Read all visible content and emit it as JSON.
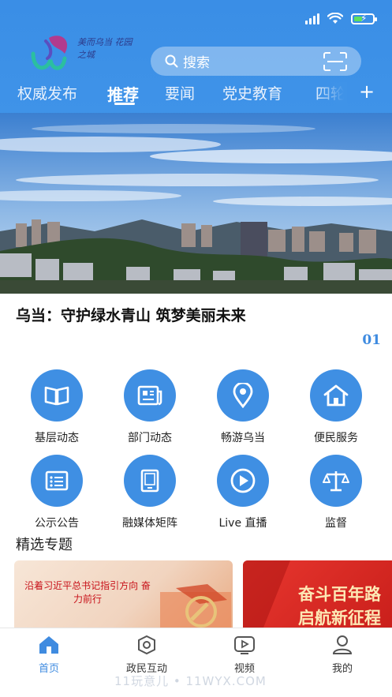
{
  "status_bar": {
    "battery_level": 0.4,
    "signal_icon": "signal-icon",
    "wifi_icon": "wifi-icon",
    "battery_icon": "battery-icon"
  },
  "header": {
    "logo_text": "美而乌当 花园之城",
    "search": {
      "placeholder": "搜索",
      "icon": "search-icon",
      "scan_icon": "scan-icon"
    },
    "tabs": [
      {
        "label": "权威发布",
        "active": false
      },
      {
        "label": "推荐",
        "active": true
      },
      {
        "label": "要闻",
        "active": false
      },
      {
        "label": "党史教育",
        "active": false
      },
      {
        "label": "四轮",
        "active": false
      }
    ],
    "add_tab_icon": "+"
  },
  "banner": {
    "title": "乌当：守护绿水青山 筑梦美丽未来",
    "index": "01"
  },
  "services": [
    {
      "label": "基层动态",
      "icon": "book-icon"
    },
    {
      "label": "部门动态",
      "icon": "newspaper-icon"
    },
    {
      "label": "畅游乌当",
      "icon": "location-pin-icon"
    },
    {
      "label": "便民服务",
      "icon": "home-icon"
    },
    {
      "label": "公示公告",
      "icon": "notice-board-icon"
    },
    {
      "label": "融媒体矩阵",
      "icon": "tablet-icon"
    },
    {
      "label": "Live 直播",
      "icon": "play-icon"
    },
    {
      "label": "监督",
      "icon": "scales-icon"
    }
  ],
  "featured": {
    "title": "精选专题",
    "cards": [
      {
        "text": "沿着习近平总书记指引方向 奋力前行"
      },
      {
        "line1": "奋斗百年路",
        "line2": "启航新征程"
      }
    ]
  },
  "tabbar": [
    {
      "label": "首页",
      "icon": "home-icon",
      "active": true
    },
    {
      "label": "政民互动",
      "icon": "interaction-icon",
      "active": false
    },
    {
      "label": "视频",
      "icon": "video-icon",
      "active": false
    },
    {
      "label": "我的",
      "icon": "user-icon",
      "active": false
    }
  ],
  "watermark": "11玩意儿 • 11WYX.COM",
  "colors": {
    "primary": "#3f8fe3",
    "accent_red": "#c8121a"
  }
}
